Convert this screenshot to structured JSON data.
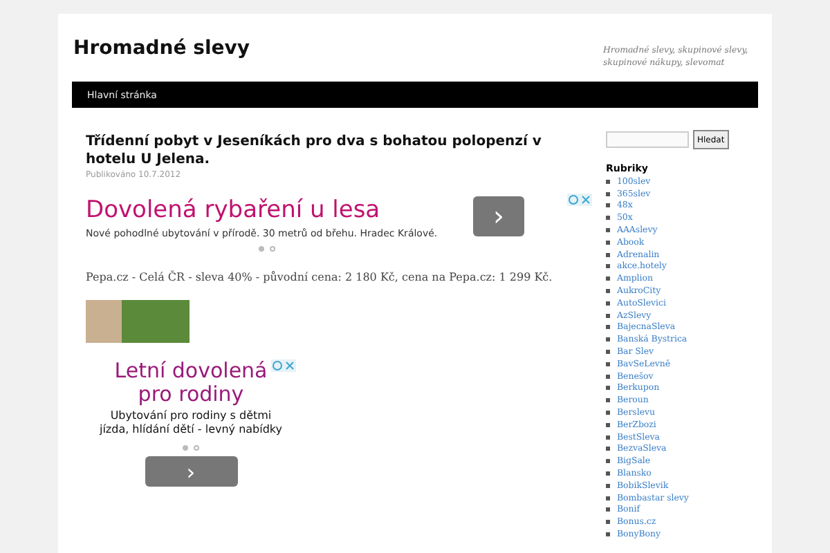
{
  "site": {
    "title": "Hromadné slevy",
    "tagline": "Hromadné slevy, skupinové slevy, skupinové nákupy, slevomat"
  },
  "nav": [
    {
      "label": "Hlavní stránka",
      "selected": false
    }
  ],
  "post": {
    "title": "Třídenní pobyt v Jeseníkách pro dva s bohatou polopenzí v hotelu U Jelena.",
    "meta": "Publikováno 10.7.2012",
    "ad1": {
      "headline": "Dovolená rybaření u lesa",
      "text": "Nové pohodlné ubytování v přírodě. 30 metrů od břehu. Hradec Králové.",
      "arrow": "›"
    },
    "body": "Pepa.cz - Celá ČR - sleva 40% - původní cena: 2 180 Kč, cena na Pepa.cz: 1 299 Kč.",
    "ad2": {
      "headline": "Letní dovolená pro rodiny",
      "text": "Ubytování pro rodiny s dětmi jízda, hlídání dětí - levný nabídky",
      "arrow": "›"
    }
  },
  "sidebar": {
    "search_button": "Hledat",
    "heading": "Rubriky",
    "categories": [
      "100slev",
      "365slev",
      "48x",
      "50x",
      "AAAslevy",
      "Abook",
      "Adrenalin",
      "akce.hotely",
      "Amplion",
      "AukroCity",
      "AutoSlevici",
      "AzSlevy",
      "BajecnaSleva",
      "Banská Bystrica",
      "Bar Slev",
      "BavSeLevně",
      "Benešov",
      "Berkupon",
      "Beroun",
      "Berslevu",
      "BerZbozi",
      "BestSleva",
      "BezvaSleva",
      "BigSale",
      "Blansko",
      "BobikSlevik",
      "Bombastar slevy",
      "Bonif",
      "Bonus.cz",
      "BonyBony"
    ]
  }
}
